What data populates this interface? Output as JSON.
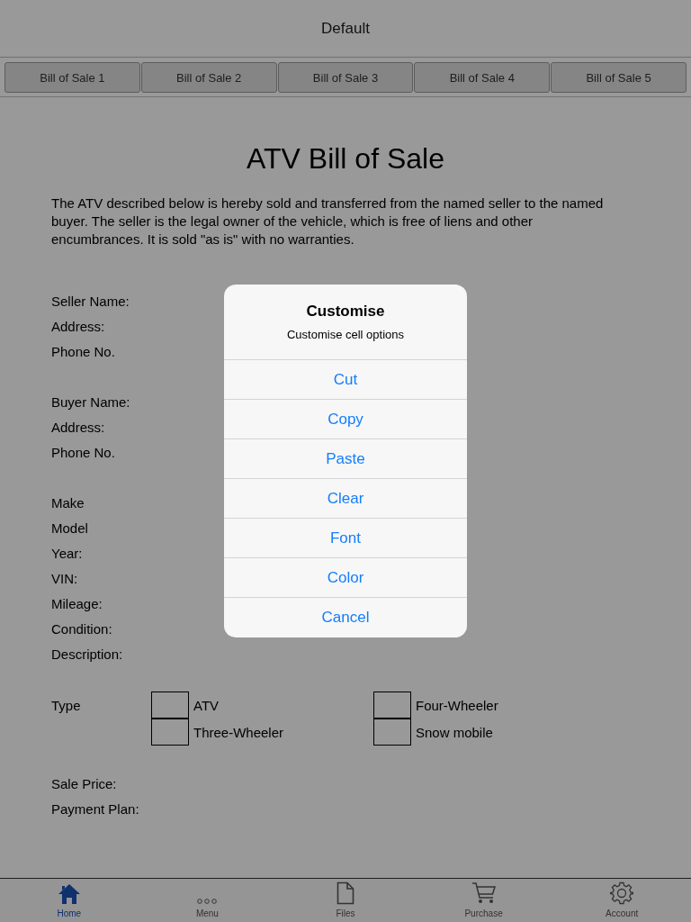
{
  "navigation_bar": {
    "title": "Default"
  },
  "segments": [
    {
      "label": "Bill of Sale 1",
      "selected": false
    },
    {
      "label": "Bill of Sale 2",
      "selected": false
    },
    {
      "label": "Bill of Sale 3",
      "selected": false
    },
    {
      "label": "Bill of Sale 4",
      "selected": false
    },
    {
      "label": "Bill of Sale 5",
      "selected": false
    }
  ],
  "document": {
    "title": "ATV Bill of Sale",
    "intro": "The ATV described below is hereby sold and transferred from the named seller to the named buyer. The seller is the legal owner of the vehicle, which is free of liens and other encumbrances. It is sold \"as is\" with no warranties.",
    "groups": [
      {
        "rows": [
          {
            "label": "Seller Name:"
          },
          {
            "label": "Address:"
          },
          {
            "label": "Phone No."
          }
        ]
      },
      {
        "rows": [
          {
            "label": "Buyer Name:"
          },
          {
            "label": "Address:"
          },
          {
            "label": "Phone No."
          }
        ]
      },
      {
        "rows": [
          {
            "label": "Make"
          },
          {
            "label": "Model"
          },
          {
            "label": "Year:"
          },
          {
            "label": "VIN:"
          },
          {
            "label": "Mileage:"
          },
          {
            "label": "Condition:"
          },
          {
            "label": "Description:"
          }
        ]
      }
    ],
    "type": {
      "label": "Type",
      "options": [
        {
          "label": "ATV",
          "checked": false
        },
        {
          "label": "Four-Wheeler",
          "checked": false
        },
        {
          "label": "Three-Wheeler",
          "checked": false
        },
        {
          "label": "Snow mobile",
          "checked": false
        }
      ]
    },
    "payment": [
      {
        "label": "Sale Price:"
      },
      {
        "label": "Payment Plan:"
      }
    ]
  },
  "tab_bar": [
    {
      "kind": "home",
      "label": "Home",
      "selected": true
    },
    {
      "kind": "menu",
      "label": "Menu",
      "selected": false
    },
    {
      "kind": "files",
      "label": "Files",
      "selected": false
    },
    {
      "kind": "purchase",
      "label": "Purchase",
      "selected": false
    },
    {
      "kind": "account",
      "label": "Account",
      "selected": false
    }
  ],
  "alert": {
    "title": "Customise",
    "message": "Customise cell options",
    "actions": [
      "Cut",
      "Copy",
      "Paste",
      "Clear",
      "Font",
      "Color",
      "Cancel"
    ]
  }
}
